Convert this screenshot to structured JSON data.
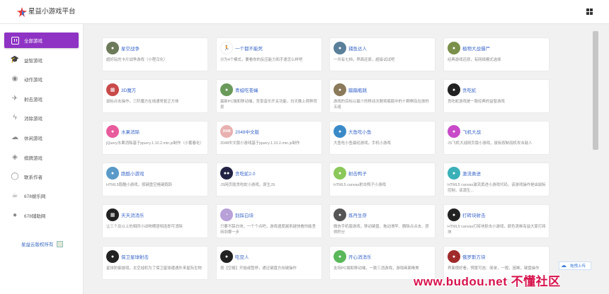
{
  "header": {
    "brand": "星益小游戏平台"
  },
  "sidebar": {
    "items": [
      {
        "label": "全部游戏",
        "icon": "twitch-icon",
        "active": true
      },
      {
        "label": "益智游戏",
        "icon": "graduation-cap-icon"
      },
      {
        "label": "动作游戏",
        "icon": "reddit-icon"
      },
      {
        "label": "射击游戏",
        "icon": "rocket-icon"
      },
      {
        "label": "消除游戏",
        "icon": "lightning-icon"
      },
      {
        "label": "休闲游戏",
        "icon": "cloud-icon"
      },
      {
        "label": "棋牌游戏",
        "icon": "puzzle-icon"
      },
      {
        "label": "联系作者",
        "icon": "user-icon"
      },
      {
        "label": "678娱乐网",
        "icon": "coffee-icon"
      },
      {
        "label": "678辅助网",
        "icon": "chat-bubble-icon"
      }
    ],
    "copyright": "星益云版权所有"
  },
  "games": [
    {
      "title": "星空战争",
      "desc": "超好玩的卡片战争游戏（小程汉化）",
      "color": "#6c7a5a",
      "glyph": "●"
    },
    {
      "title": "一个都不能死",
      "desc": "分为4个模式，要看你的反应能力和手速怎么样吧",
      "color": "#ffffff",
      "glyph": "🏃"
    },
    {
      "title": "捕鱼达人",
      "desc": "一共有七档，界面还原，超级试试吧",
      "color": "#5a7f9a",
      "glyph": "●"
    },
    {
      "title": "植物大战僵尸",
      "desc": "经典游戏还原，有网络模式选择",
      "color": "#7a8f4a",
      "glyph": "●"
    },
    {
      "title": "3D魔方",
      "desc": "鼠标点击操作，三阶魔方在线通常复正方体",
      "color": "#c84a4a",
      "glyph": "▦"
    },
    {
      "title": "青蛙吃苍蝇",
      "desc": "最新PC端和移动端，背景音乐开关功能，白天晚上两种背景",
      "color": "#6a9a5a",
      "glyph": "●"
    },
    {
      "title": "蹦蹦瓶跳",
      "desc": "游戏的目标以最少的移动次数将瓶瓶中的十颗棋及在放的五组",
      "color": "#8a7a5a",
      "glyph": "●"
    },
    {
      "title": "贪吃蛇",
      "desc": "贪吃蛇游戏是一款经典的益智游戏",
      "color": "#222222",
      "glyph": "●"
    },
    {
      "title": "水果消除",
      "desc": "jQuery水果消除基于jquery.1.10.2.min.js制作（小蓄春化）",
      "color": "#e85c9e",
      "glyph": "●"
    },
    {
      "title": "2048中文版",
      "desc": "2048中文版小游戏基于jquery.1.10.2.min.js制作",
      "color": "#e8b0b0",
      "glyph": "2048"
    },
    {
      "title": "大鱼吃小鱼",
      "desc": "大鱼吃小鱼最经游戏，手机小游戏",
      "color": "#3a8ac8",
      "glyph": "●"
    },
    {
      "title": "飞机大战",
      "desc": "JS飞机大战网页版小游戏，鼠标按制战机攻击敌人",
      "color": "#c84ac8",
      "glyph": "●"
    },
    {
      "title": "跑酷小游戏",
      "desc": "HTML5跑酷小游戏，按键盘空格键跑跃",
      "color": "#5a9ac8",
      "glyph": "●"
    },
    {
      "title": "贪吃蛇2.0",
      "desc": "JS网页版贪吃蛇小游戏，原生JS",
      "color": "#222244",
      "glyph": "●●"
    },
    {
      "title": "射击鸭子",
      "desc": "HTML5 canvas射击鸭子小游戏",
      "color": "#8ac85a",
      "glyph": "●"
    },
    {
      "title": "激流勇进",
      "desc": "HTML5 canvas激流勇进小游戏代码，该游戏操作是由鼠标控制，该源生...",
      "color": "#3ab0b8",
      "glyph": "●"
    },
    {
      "title": "天天消消乐",
      "desc": "让三个及以上的相同小动物横竖相连即可消除",
      "color": "#222222",
      "glyph": "▦"
    },
    {
      "title": "别踩白块",
      "desc": "只要不踩白块，一个个点吧，游戏速度越来越快看你能坚持到哪一步",
      "color": "#b8a0d8",
      "glyph": "◔"
    },
    {
      "title": "炼丹生存",
      "desc": "微信手机版游戏，移动键盘、拖动滑竿、删除点点击、获得积分",
      "color": "#555555",
      "glyph": "●"
    },
    {
      "title": "打砖块射击",
      "desc": "HTML5 canvas打砖块射击小游戏，颜色清晰有益大家打砖块",
      "color": "#222222",
      "glyph": "●"
    },
    {
      "title": "保卫星球射击",
      "desc": "星球防御游戏，太空战机为了保卫星球遭遇外来星际生物",
      "color": "#222222",
      "glyph": "●"
    },
    {
      "title": "吃豆人",
      "desc": "按【空格】开始或暂停，通过键盘方向键操作",
      "color": "#222222",
      "glyph": "●"
    },
    {
      "title": "开心消消乐",
      "desc": "支持PC端和移动端，一款三消游戏，游戏画面唯美",
      "color": "#5ab85a",
      "glyph": "●"
    },
    {
      "title": "俄罗斯方块",
      "desc": "界面很好看，预置可选：简单，一般，困难，键盘操作",
      "color": "#a02a2a",
      "glyph": "●"
    }
  ],
  "upload": {
    "label": "拖拽上传"
  },
  "watermark": "www.budou.net 不懂社区"
}
